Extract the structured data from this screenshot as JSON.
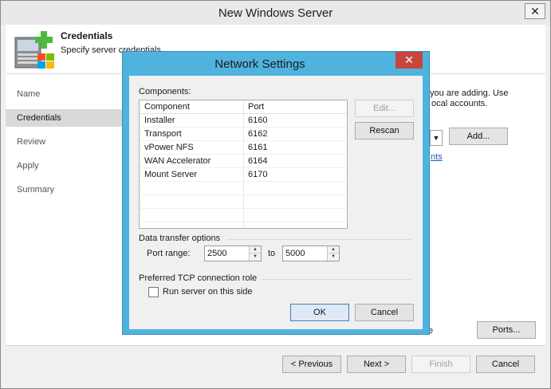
{
  "main": {
    "title": "New Windows Server",
    "close_glyph": "✕",
    "header": {
      "title": "Credentials",
      "subtitle": "Specify server credentials"
    },
    "nav": [
      {
        "label": "Name",
        "active": false
      },
      {
        "label": "Credentials",
        "active": true
      },
      {
        "label": "Review",
        "active": false
      },
      {
        "label": "Apply",
        "active": false
      },
      {
        "label": "Summary",
        "active": false
      }
    ],
    "content": {
      "desc_line1": "you are adding. Use",
      "desc_line2": "ocal accounts.",
      "add_button": "Add...",
      "link_fragment": "nts",
      "tail_fragment": "e",
      "ports_button": "Ports..."
    },
    "footer": {
      "previous": "< Previous",
      "next": "Next >",
      "finish": "Finish",
      "cancel": "Cancel"
    }
  },
  "dialog": {
    "title": "Network Settings",
    "close_glyph": "✕",
    "components_label": "Components:",
    "columns": {
      "component": "Component",
      "port": "Port"
    },
    "rows": [
      {
        "component": "Installer",
        "port": "6160"
      },
      {
        "component": "Transport",
        "port": "6162"
      },
      {
        "component": "vPower NFS",
        "port": "6161"
      },
      {
        "component": "WAN Accelerator",
        "port": "6164"
      },
      {
        "component": "Mount Server",
        "port": "6170"
      }
    ],
    "edit_button": "Edit...",
    "rescan_button": "Rescan",
    "data_transfer": {
      "group_label": "Data transfer options",
      "port_range_label": "Port range:",
      "from": "2500",
      "to_label": "to",
      "to": "5000"
    },
    "tcp_role": {
      "group_label": "Preferred TCP connection role",
      "checkbox_label": "Run server on this side",
      "checked": false
    },
    "ok_button": "OK",
    "cancel_button": "Cancel"
  },
  "colors": {
    "dialog_frame": "#4fb3de",
    "close_red": "#c7463c",
    "link_blue": "#1a5fb4"
  }
}
